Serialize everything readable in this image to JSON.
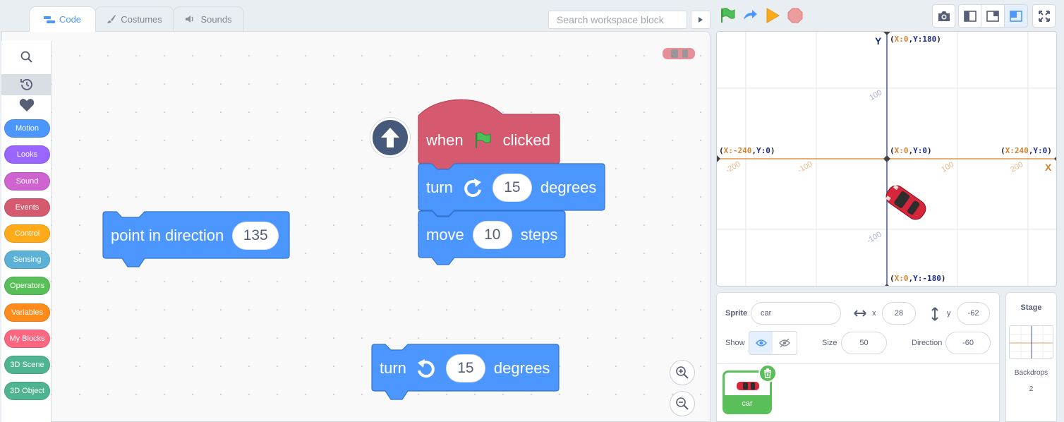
{
  "tabs": [
    {
      "label": "Code",
      "active": true
    },
    {
      "label": "Costumes",
      "active": false
    },
    {
      "label": "Sounds",
      "active": false
    }
  ],
  "search": {
    "placeholder": "Search workspace block"
  },
  "categories": [
    {
      "label": "Motion",
      "color": "#4c97ff"
    },
    {
      "label": "Looks",
      "color": "#9966ff"
    },
    {
      "label": "Sound",
      "color": "#cf63cf"
    },
    {
      "label": "Events",
      "color": "#d65a6f"
    },
    {
      "label": "Control",
      "color": "#ffab19"
    },
    {
      "label": "Sensing",
      "color": "#5cb1d6"
    },
    {
      "label": "Operators",
      "color": "#59c059"
    },
    {
      "label": "Variables",
      "color": "#ff8c1a"
    },
    {
      "label": "My Blocks",
      "color": "#ff6680"
    },
    {
      "label": "3D Scene",
      "color": "#4fb491"
    },
    {
      "label": "3D Object",
      "color": "#4fb491"
    }
  ],
  "blocks": {
    "hat": {
      "pre": "when",
      "post": "clicked"
    },
    "turn_cw": {
      "pre": "turn",
      "value": "15",
      "post": "degrees"
    },
    "move": {
      "pre": "move",
      "value": "10",
      "post": "steps"
    },
    "point": {
      "pre": "point in direction",
      "value": "135"
    },
    "turn_ccw": {
      "pre": "turn",
      "value": "15",
      "post": "degrees"
    }
  },
  "stage": {
    "axis_x": "X",
    "axis_y": "Y",
    "coords": {
      "top": {
        "x": "X:0",
        "y": "Y:180"
      },
      "left": {
        "x": "X:-240",
        "y": "Y:0"
      },
      "origin": {
        "x": "X:0",
        "y": "Y:0"
      },
      "right": {
        "x": "X:240",
        "y": "Y:0"
      },
      "bottom": {
        "x": "X:0",
        "y": "Y:-180"
      }
    },
    "ticks_x": [
      "-200",
      "-100",
      "100",
      "200"
    ],
    "ticks_y": [
      "100",
      "-100"
    ]
  },
  "sprite_info": {
    "sprite_label": "Sprite",
    "sprite_name": "car",
    "x_label": "x",
    "x_value": "28",
    "y_label": "y",
    "y_value": "-62",
    "show_label": "Show",
    "size_label": "Size",
    "size_value": "50",
    "direction_label": "Direction",
    "direction_value": "-60"
  },
  "sprites": [
    {
      "name": "car"
    }
  ],
  "stage_pane": {
    "title": "Stage",
    "backdrops_label": "Backdrops",
    "backdrops_count": "2"
  },
  "colors": {
    "motion": "#4c97ff",
    "events": "#d65a6f",
    "green": "#59c059"
  }
}
